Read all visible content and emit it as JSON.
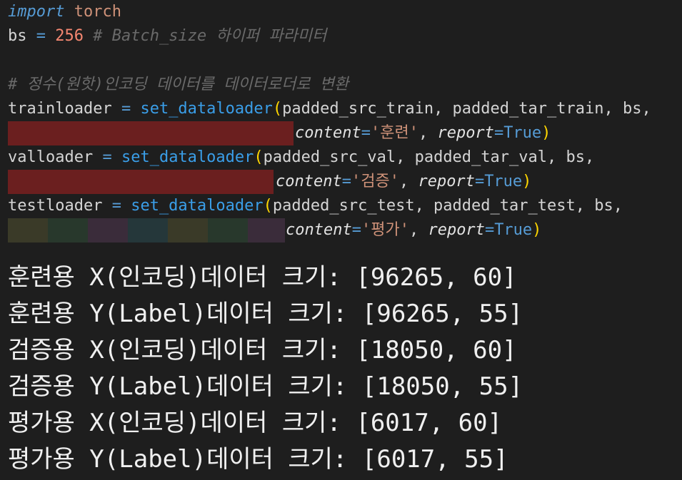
{
  "code": {
    "line1": {
      "keyword": "import",
      "module": "torch"
    },
    "line2": {
      "var": "bs",
      "op": "=",
      "value": "256",
      "comment": "# Batch_size 하이퍼 파라미터"
    },
    "line4": {
      "comment": "# 정수(원핫)인코딩 데이터를 데이터로더로 변환"
    },
    "train": {
      "var": "trainloader",
      "op": "=",
      "fn": "set_dataloader",
      "open": "(",
      "args": "padded_src_train, padded_tar_train, bs,",
      "content_kw": "content",
      "eq": "=",
      "content_val": "'훈련'",
      "sep": ",",
      "report_kw": "report",
      "report_val": "True",
      "close": ")"
    },
    "val": {
      "var": "valloader",
      "op": "=",
      "fn": "set_dataloader",
      "open": "(",
      "args": "padded_src_val, padded_tar_val, bs,",
      "content_kw": "content",
      "eq": "=",
      "content_val": "'검증'",
      "sep": ",",
      "report_kw": "report",
      "report_val": "True",
      "close": ")"
    },
    "test": {
      "var": "testloader",
      "op": "=",
      "fn": "set_dataloader",
      "open": "(",
      "args": "padded_src_test, padded_tar_test, bs,",
      "content_kw": "content",
      "eq": "=",
      "content_val": "'평가'",
      "sep": ",",
      "report_kw": "report",
      "report_val": "True",
      "close": ")"
    }
  },
  "output": [
    "훈련용 X(인코딩)데이터 크기: [96265, 60]",
    "훈련용 Y(Label)데이터 크기: [96265, 55]",
    "검증용 X(인코딩)데이터 크기: [18050, 60]",
    "검증용 Y(Label)데이터 크기: [18050, 55]",
    "평가용 X(인코딩)데이터 크기: [6017, 60]",
    "평가용 Y(Label)데이터 크기: [6017, 55]"
  ],
  "colors": {
    "background": "#1e1e1e",
    "keyword": "#569cd6",
    "string": "#ce9178",
    "function": "#3a9ee8",
    "bracket": "#ffd700",
    "number": "#f48771",
    "comment": "#6a6a6a"
  }
}
